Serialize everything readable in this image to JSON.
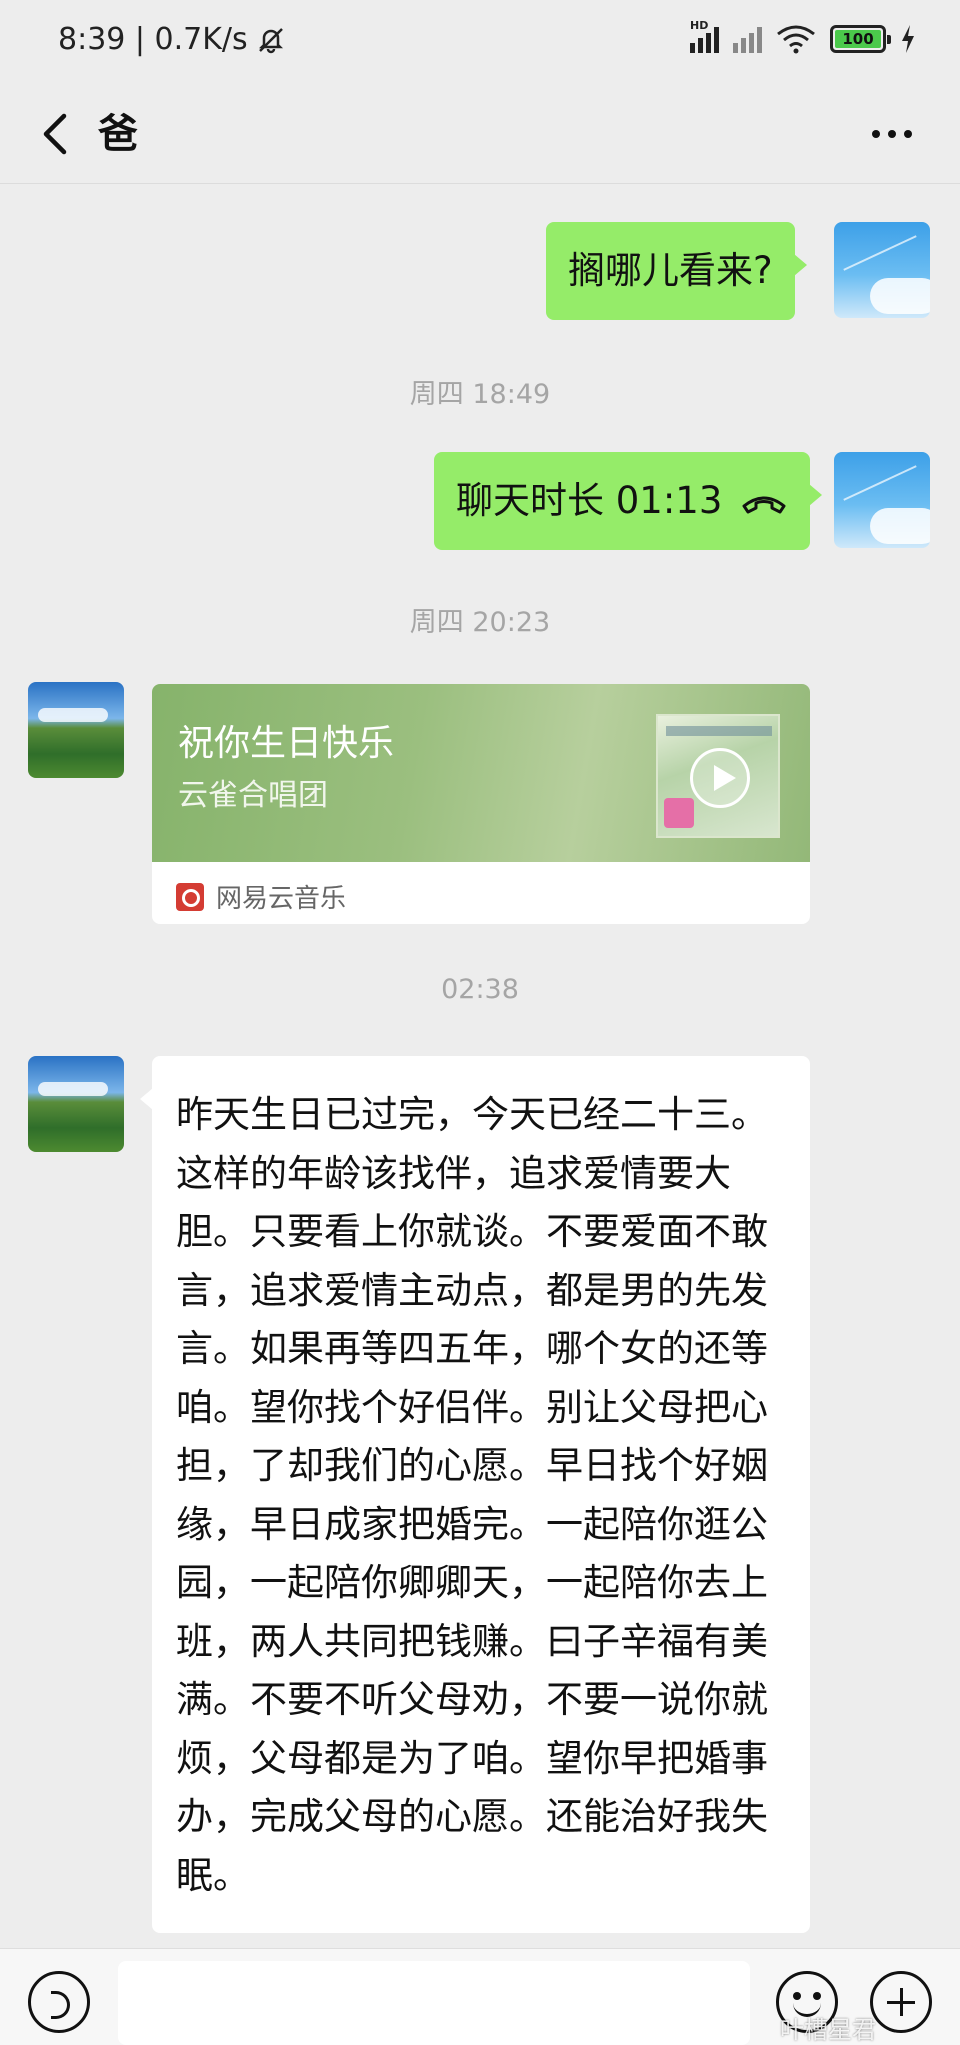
{
  "status_bar": {
    "time_speed": "8:39 | 0.7K/s",
    "signal_label": "HD",
    "battery_level": "100"
  },
  "nav": {
    "title": "爸"
  },
  "messages": [
    {
      "type": "text",
      "side": "right",
      "text": "搁哪儿看来?"
    },
    {
      "type": "timestamp",
      "text": "周四 18:49"
    },
    {
      "type": "call",
      "side": "right",
      "text": "聊天时长 01:13"
    },
    {
      "type": "timestamp",
      "text": "周四 20:23"
    },
    {
      "type": "music",
      "side": "left",
      "title": "祝你生日快乐",
      "artist": "云雀合唱团",
      "source": "网易云音乐"
    },
    {
      "type": "timestamp",
      "text": "02:38"
    },
    {
      "type": "text",
      "side": "left",
      "text": "昨天生日已过完，今天已经二十三。这样的年龄该找伴，追求爱情要大胆。只要看上你就谈。不要爱面不敢言，追求爱情主动点，都是男的先发言。如果再等四五年，哪个女的还等咱。望你找个好侣伴。别让父母把心担，了却我们的心愿。早日找个好姻缘，早日成家把婚完。一起陪你逛公园，一起陪你卿卿天，一起陪你去上班，两人共同把钱赚。曰子辛福有美满。不要不听父母劝，不要一说你就烦，父母都是为了咱。望你早把婚事办，完成父母的心愿。还能治好我失眠。"
    }
  ],
  "input_bar": {
    "value": ""
  },
  "watermark": "叶槽星君",
  "colors": {
    "bubble_green": "#95ec69",
    "background": "#ededed",
    "netease_red": "#d43c33"
  }
}
